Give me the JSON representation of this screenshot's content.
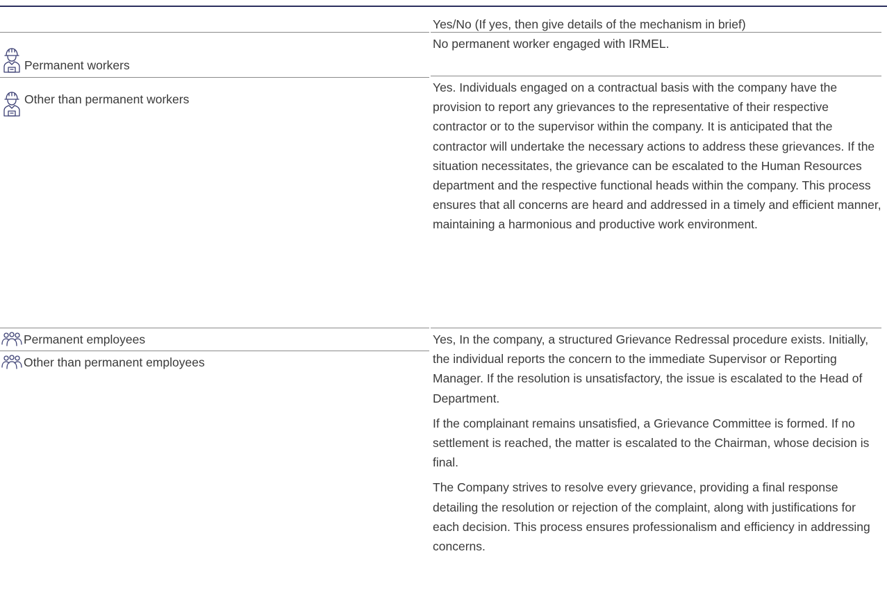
{
  "table": {
    "header": "Yes/No (If yes, then give details of the mechanism in brief)",
    "rows": [
      {
        "label": "Permanent workers",
        "icon": "worker-icon",
        "text": [
          "No permanent worker engaged with IRMEL."
        ]
      },
      {
        "label": "Other than permanent workers",
        "icon": "worker-icon",
        "text": [
          "Yes. Individuals engaged on a contractual basis with the company have the provision to report any grievances to the representative of their respective contractor or to the supervisor within the company. It is anticipated that the contractor will undertake the necessary actions to address these grievances. If the situation necessitates, the grievance can be escalated to the Human Resources department and the respective functional heads within the company. This process ensures that all concerns are heard and addressed in a timely and efficient manner, maintaining a harmonious and productive work environment."
        ]
      },
      {
        "label": "Permanent employees",
        "icon": "people-group-icon"
      },
      {
        "label": "Other than permanent employees",
        "icon": "people-group-icon",
        "text": [
          "Yes, In the company, a structured Grievance Redressal procedure exists. Initially, the individual reports the concern to the immediate Supervisor or Reporting Manager. If the resolution is unsatisfactory, the issue is escalated to the Head of Department.",
          "If the complainant remains unsatisfied, a Grievance Committee is formed. If no settlement is reached, the matter is escalated to the Chairman, whose decision is final.",
          "The Company strives to resolve every grievance, providing a final response detailing the resolution or rejection of the complaint, along with justifications for each decision. This process ensures professionalism and efficiency in addressing concerns."
        ]
      }
    ]
  },
  "colors": {
    "top_rule": "#2b2f5e",
    "icon_stroke": "#3b3f73",
    "text": "#3a3a3a",
    "rule": "#8a8a8a"
  }
}
